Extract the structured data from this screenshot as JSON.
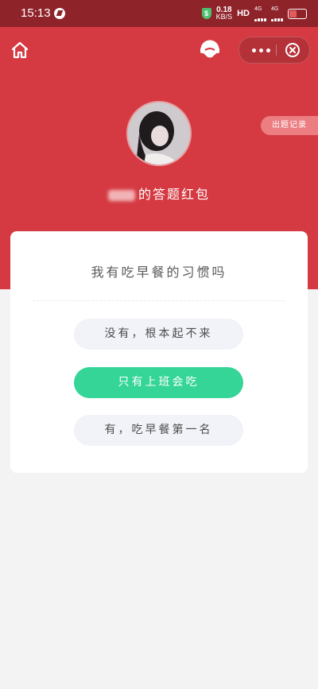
{
  "status_bar": {
    "time": "15:13",
    "speed_value": "0.18",
    "speed_unit": "KB/S",
    "hd": "HD",
    "network1": "4G",
    "network2": "4G"
  },
  "nav": {
    "home_icon": "home-icon",
    "service_icon": "headset-icon",
    "more_icon": "more-dots-icon",
    "close_icon": "close-circle-icon"
  },
  "header": {
    "record_button": "出题记录",
    "title_suffix": "的答题红包"
  },
  "quiz": {
    "question": "我有吃早餐的习惯吗",
    "options": [
      {
        "label": "没有，根本起不来",
        "selected": false
      },
      {
        "label": "只有上班会吃",
        "selected": true
      },
      {
        "label": "有，吃早餐第一名",
        "selected": false
      }
    ]
  },
  "colors": {
    "brand_red": "#d53a42",
    "selected_green": "#34d597",
    "option_bg": "#f1f3f8"
  }
}
